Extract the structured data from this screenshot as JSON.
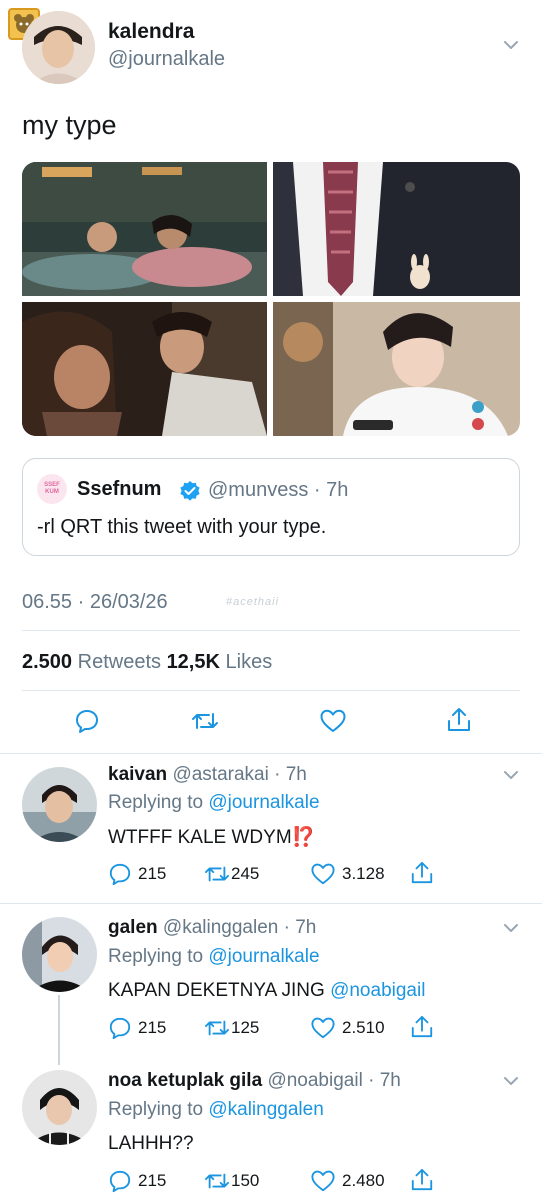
{
  "watermark_badge": "",
  "tweet": {
    "display_name": "kalendra",
    "handle": "@journalkale",
    "text": "my type",
    "quote": {
      "display_name": "Ssefnum",
      "handle": "@munvess",
      "time": "7h",
      "text": "-rl QRT this tweet with your type.",
      "avatar_text": "SSEF KUM"
    },
    "timestamp": "06.55 · 26/03/26",
    "watermark": "#acethaii",
    "retweets_count": "2.500",
    "retweets_label": "Retweets",
    "likes_count": "12,5K",
    "likes_label": "Likes",
    "colors": {
      "accent": "#1b95e0",
      "verified": "#1da1f2",
      "muted": "#657786"
    }
  },
  "replies": [
    {
      "display_name": "kaivan",
      "handle": "@astarakai",
      "time": "7h",
      "replying_prefix": "Replying to",
      "replying_to": "@journalkale",
      "text": "WTFFF KALE WDYM",
      "emoji": "⁉️",
      "mention": "",
      "replies": "215",
      "retweets": "245",
      "likes": "3.128"
    },
    {
      "display_name": "galen",
      "handle": "@kalinggalen",
      "time": "7h",
      "replying_prefix": "Replying to",
      "replying_to": "@journalkale",
      "text": "KAPAN DEKETNYA JING",
      "emoji": "",
      "mention": "@noabigail",
      "replies": "215",
      "retweets": "125",
      "likes": "2.510"
    },
    {
      "display_name": "noa ketuplak gila",
      "handle": "@noabigail",
      "time": "7h",
      "replying_prefix": "Replying to",
      "replying_to": "@kalinggalen",
      "text": "LAHHH??",
      "emoji": "",
      "mention": "",
      "replies": "215",
      "retweets": "150",
      "likes": "2.480"
    }
  ]
}
